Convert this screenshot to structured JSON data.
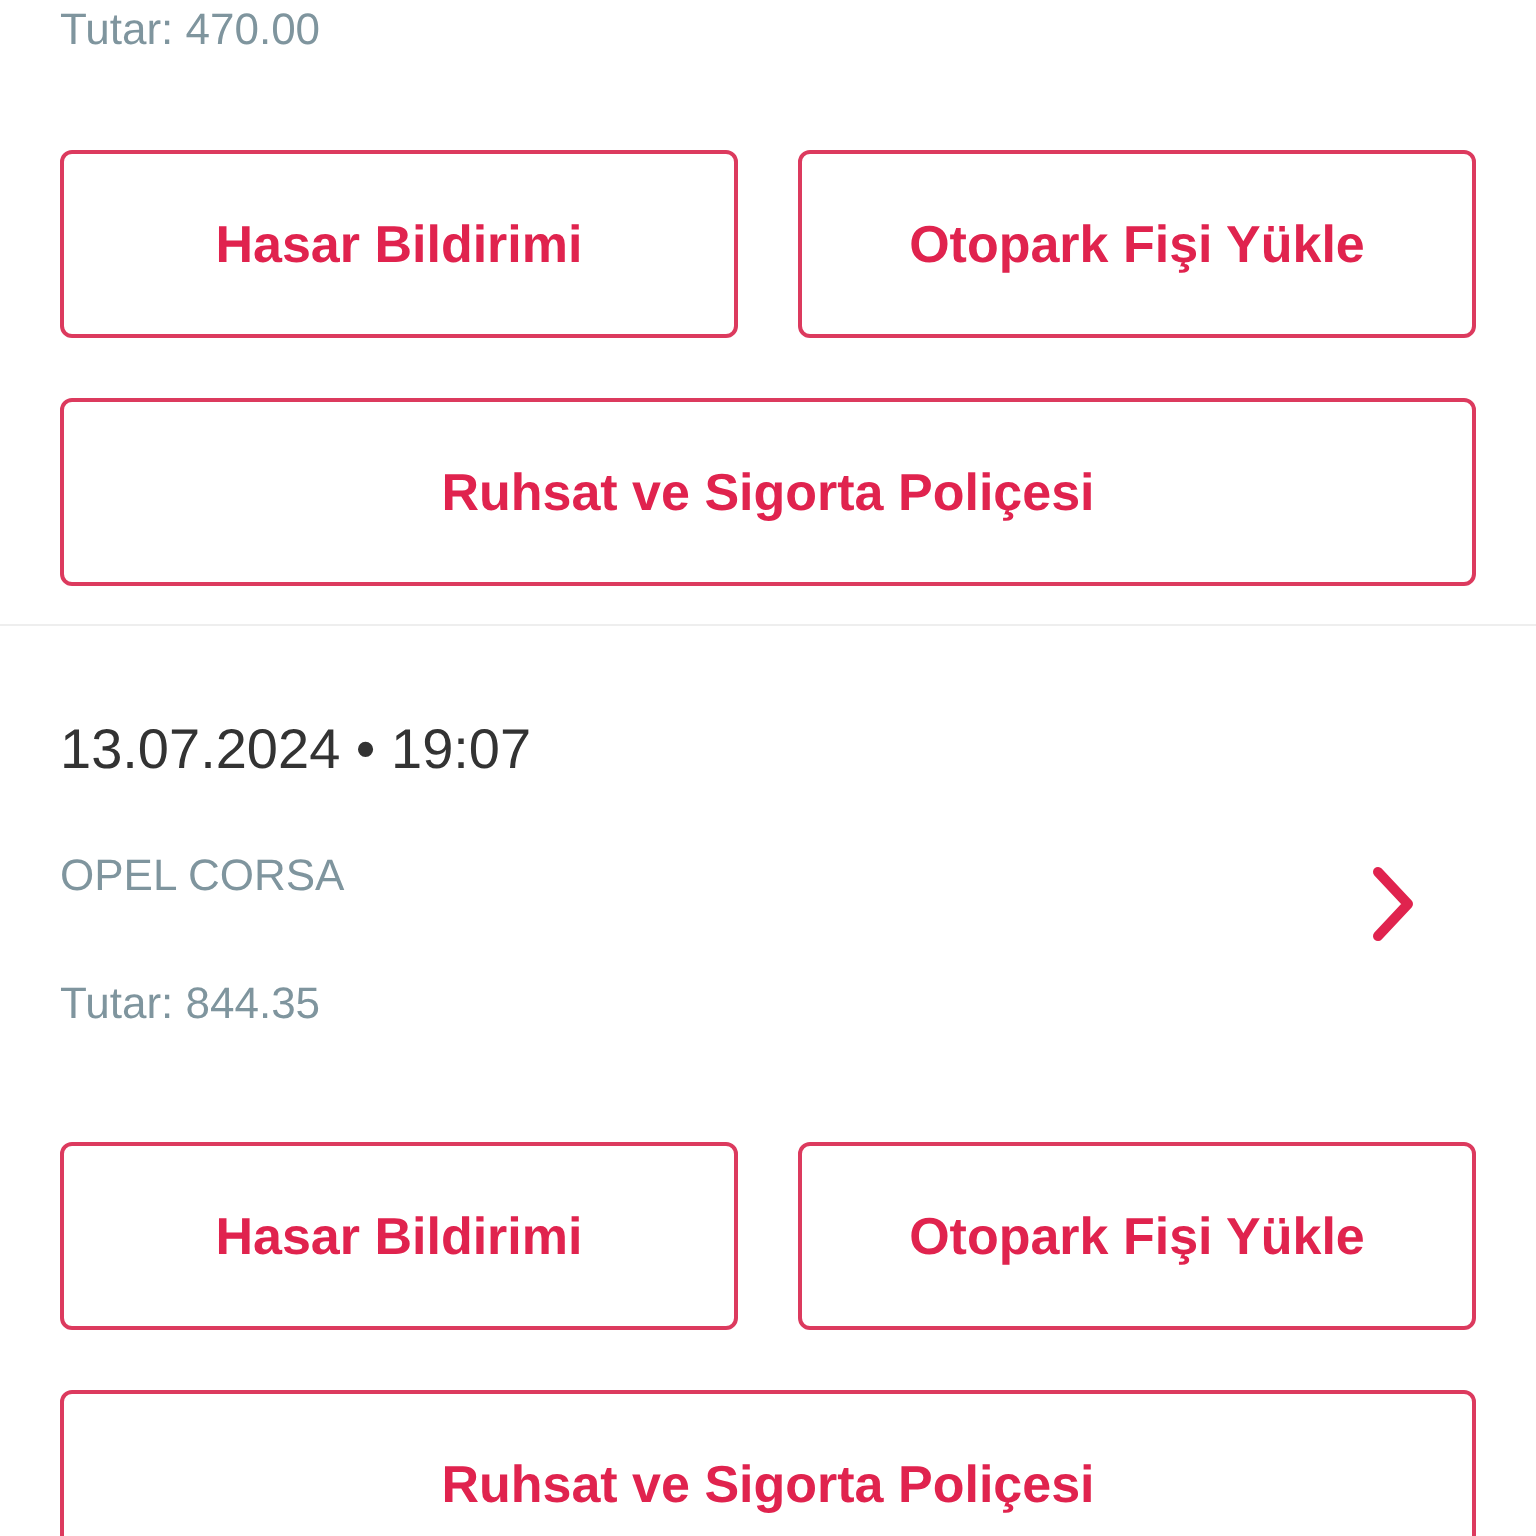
{
  "records": [
    {
      "amount": "Tutar: 470.00",
      "actions": [
        "Hasar Bildirimi",
        "Otopark Fişi Yükle",
        "Ruhsat ve Sigorta Poliçesi"
      ]
    },
    {
      "date": "13.07.2024 • 19:07",
      "vehicle": "OPEL CORSA",
      "chevron": true,
      "amount": "Tutar: 844.35",
      "actions": [
        "Hasar Bildirimi",
        "Otopark Fişi Yükle",
        "Ruhsat ve Sigorta Poliçesi"
      ]
    }
  ]
}
